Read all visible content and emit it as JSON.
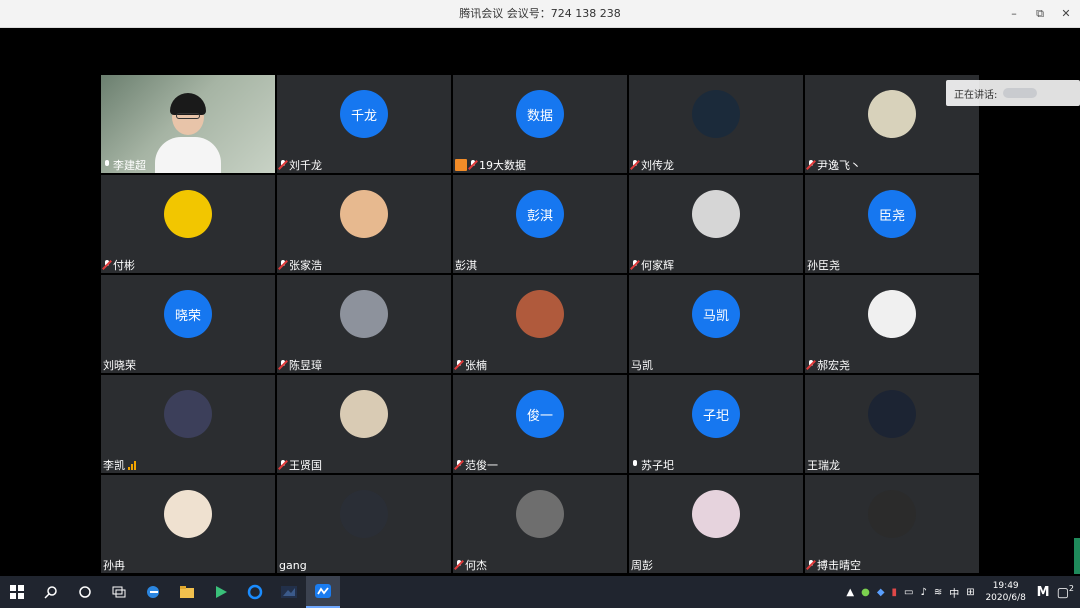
{
  "window": {
    "title": "腾讯会议 会议号：724 138 238",
    "minimize": "–",
    "restore": "⧉",
    "close": "✕"
  },
  "speaking": {
    "label": "正在讲话:"
  },
  "participants": [
    {
      "name": "李建超",
      "type": "video",
      "mic": "on"
    },
    {
      "name": "刘千龙",
      "type": "text",
      "avatar_text": "千龙",
      "mic": "muted"
    },
    {
      "name": "19大数据",
      "type": "text",
      "avatar_text": "数据",
      "mic": "muted",
      "badge": true
    },
    {
      "name": "刘传龙",
      "type": "img",
      "avatar_color": "#1b2a3a",
      "mic": "muted"
    },
    {
      "name": "尹逸飞丶",
      "type": "img",
      "avatar_color": "#d8d2bb",
      "mic": "muted"
    },
    {
      "name": "付彬",
      "type": "img",
      "avatar_color": "#f2c600",
      "mic": "muted"
    },
    {
      "name": "张家浩",
      "type": "img",
      "avatar_color": "#e7b98f",
      "mic": "muted"
    },
    {
      "name": "彭淇",
      "type": "text",
      "avatar_text": "彭淇",
      "mic": "none"
    },
    {
      "name": "何家辉",
      "type": "img",
      "avatar_color": "#d6d6d6",
      "mic": "muted"
    },
    {
      "name": "孙臣尧",
      "type": "text",
      "avatar_text": "臣尧",
      "mic": "none"
    },
    {
      "name": "刘晓荣",
      "type": "text",
      "avatar_text": "晓荣",
      "mic": "none"
    },
    {
      "name": "陈昱璋",
      "type": "img",
      "avatar_color": "#8d929c",
      "mic": "muted"
    },
    {
      "name": "张楠",
      "type": "img",
      "avatar_color": "#b05a3c",
      "mic": "muted"
    },
    {
      "name": "马凯",
      "type": "text",
      "avatar_text": "马凯",
      "mic": "none"
    },
    {
      "name": "郝宏尧",
      "type": "img",
      "avatar_color": "#f0f0f0",
      "mic": "muted"
    },
    {
      "name": "李凯",
      "type": "img",
      "avatar_color": "#3c3f5a",
      "mic": "bars"
    },
    {
      "name": "王贤国",
      "type": "img",
      "avatar_color": "#d9cbb4",
      "mic": "muted"
    },
    {
      "name": "范俊一",
      "type": "text",
      "avatar_text": "俊一",
      "mic": "muted"
    },
    {
      "name": "苏子圯",
      "type": "text",
      "avatar_text": "子圯",
      "mic": "on"
    },
    {
      "name": "王瑞龙",
      "type": "img",
      "avatar_color": "#1c2433",
      "mic": "none"
    },
    {
      "name": "孙冉",
      "type": "img",
      "avatar_color": "#efe1d0",
      "mic": "none"
    },
    {
      "name": "gang",
      "type": "img",
      "avatar_color": "#2a2e36",
      "mic": "none"
    },
    {
      "name": "何杰",
      "type": "img",
      "avatar_color": "#6e6e6e",
      "mic": "muted"
    },
    {
      "name": "周彭",
      "type": "img",
      "avatar_color": "#e6d3dd",
      "mic": "none"
    },
    {
      "name": "搏击晴空",
      "type": "img",
      "avatar_color": "#2b2b2b",
      "mic": "muted"
    }
  ],
  "taskbar": {
    "start_icon": "windows-logo-icon",
    "search_icon": "search-icon",
    "cortana_icon": "circle-icon",
    "taskview_icon": "task-view-icon",
    "tray_ime": "中",
    "time": "19:49",
    "date": "2020/6/8",
    "notification_count": "2"
  },
  "colors": {
    "avatar_blue": "#1677f0",
    "tile_bg": "#2b2d30",
    "muted_red": "#e03b3b",
    "badge_orange": "#f28c28"
  }
}
